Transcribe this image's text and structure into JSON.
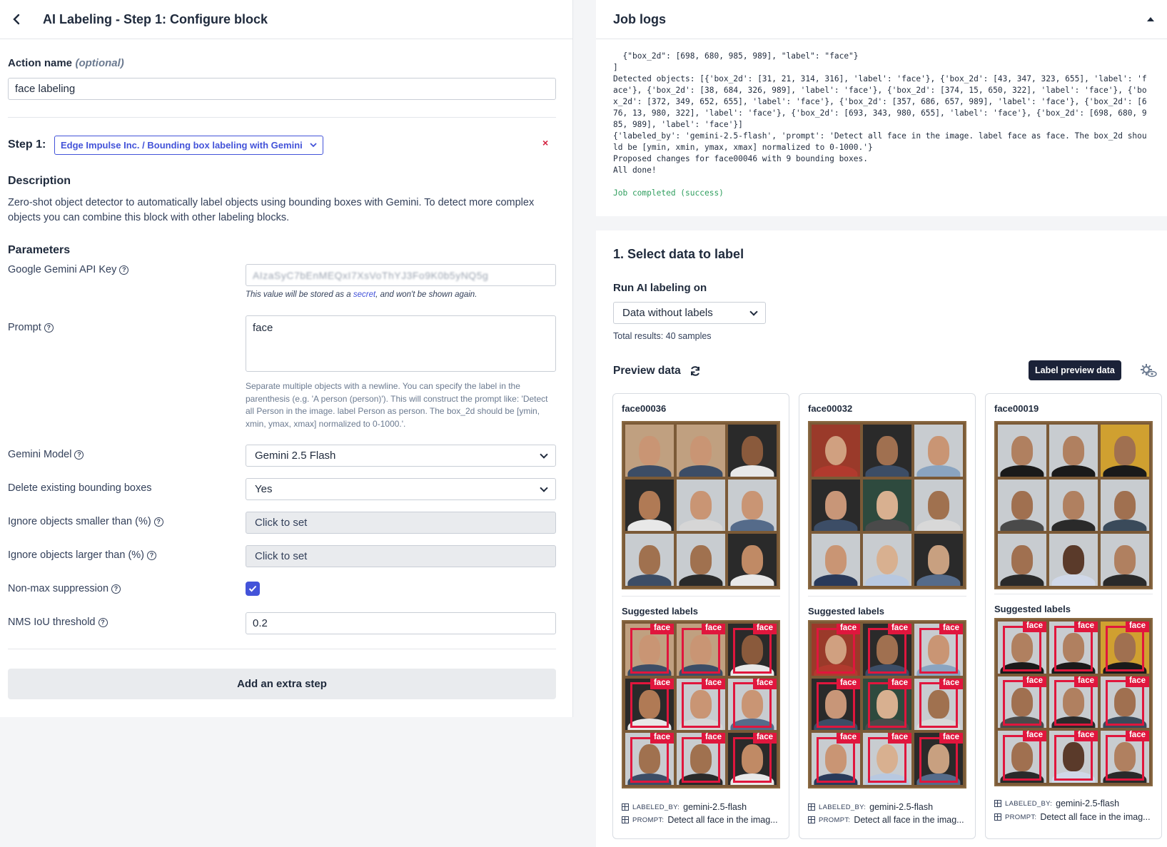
{
  "left_panel": {
    "title": "AI Labeling - Step 1: Configure block",
    "action_name_label": "Action name",
    "action_name_optional": "(optional)",
    "action_name_value": "face labeling",
    "step_label": "Step 1:",
    "step_block": "Edge Impulse Inc. / Bounding box labeling with Gemini",
    "remove_symbol": "×",
    "description_heading": "Description",
    "description_text": "Zero-shot object detector to automatically label objects using bounding boxes with Gemini. To detect more complex objects you can combine this block with other labeling blocks.",
    "parameters_heading": "Parameters",
    "api_key_label": "Google Gemini API Key",
    "api_key_value": "AIzaSyC7bEnMEQxI7XsVoThYJ3Fo9K0b5yNQ5g",
    "api_key_note_prefix": "This value will be stored as a ",
    "api_key_note_link": "secret",
    "api_key_note_suffix": ", and won't be shown again.",
    "prompt_label": "Prompt",
    "prompt_value": "face",
    "prompt_help": "Separate multiple objects with a newline. You can specify the label in the parenthesis (e.g. 'A person (person)'). This will construct the prompt like: 'Detect all Person in the image. label Person as person. The box_2d should be [ymin, xmin, ymax, xmax] normalized to 0-1000.'.",
    "model_label": "Gemini Model",
    "model_value": "Gemini 2.5 Flash",
    "delete_label": "Delete existing bounding boxes",
    "delete_value": "Yes",
    "smaller_label": "Ignore objects smaller than (%)",
    "smaller_value": "Click to set",
    "larger_label": "Ignore objects larger than (%)",
    "larger_value": "Click to set",
    "nms_label": "Non-max suppression",
    "nms_checked": true,
    "iou_label": "NMS IoU threshold",
    "iou_value": "0.2",
    "add_step_label": "Add an extra step",
    "help_glyph": "?"
  },
  "job_logs": {
    "title": "Job logs",
    "log_text": "  {\"box_2d\": [698, 680, 985, 989], \"label\": \"face\"}\n]\nDetected objects: [{'box_2d': [31, 21, 314, 316], 'label': 'face'}, {'box_2d': [43, 347, 323, 655], 'label': 'face'}, {'box_2d': [38, 684, 326, 989], 'label': 'face'}, {'box_2d': [374, 15, 650, 322], 'label': 'face'}, {'box_2d': [372, 349, 652, 655], 'label': 'face'}, {'box_2d': [357, 686, 657, 989], 'label': 'face'}, {'box_2d': [676, 13, 980, 322], 'label': 'face'}, {'box_2d': [693, 343, 980, 655], 'label': 'face'}, {'box_2d': [698, 680, 985, 989], 'label': 'face'}]\n{'labeled_by': 'gemini-2.5-flash', 'prompt': 'Detect all face in the image. label face as face. The box_2d should be [ymin, xmin, ymax, xmax] normalized to 0-1000.'}\nProposed changes for face00046 with 9 bounding boxes.\nAll done!",
    "status": "Job completed (success)"
  },
  "select_data": {
    "title": "1. Select data to label",
    "run_on_label": "Run AI labeling on",
    "run_on_value": "Data without labels",
    "total": "Total results: 40 samples",
    "preview_title": "Preview data",
    "label_preview_button": "Label preview data",
    "suggested_labels": "Suggested labels",
    "tag_label": "face",
    "cards": [
      {
        "name": "face00036",
        "labeled_by_key": "LABELED_BY:",
        "labeled_by_value": "gemini-2.5-flash",
        "prompt_key": "PROMPT:",
        "prompt_value": "Detect all face in the imag..."
      },
      {
        "name": "face00032",
        "labeled_by_key": "LABELED_BY:",
        "labeled_by_value": "gemini-2.5-flash",
        "prompt_key": "PROMPT:",
        "prompt_value": "Detect all face in the imag..."
      },
      {
        "name": "face00019",
        "labeled_by_key": "LABELED_BY:",
        "labeled_by_value": "gemini-2.5-flash",
        "prompt_key": "PROMPT:",
        "prompt_value": "Detect all face in the imag..."
      }
    ]
  },
  "icons": [
    "chevron-left-icon",
    "chevron-down-icon",
    "close-icon",
    "help-icon",
    "checkbox-check-icon",
    "caret-up-icon",
    "refresh-icon",
    "settings-eye-icon",
    "table-icon",
    "face-thumbnail-image"
  ]
}
